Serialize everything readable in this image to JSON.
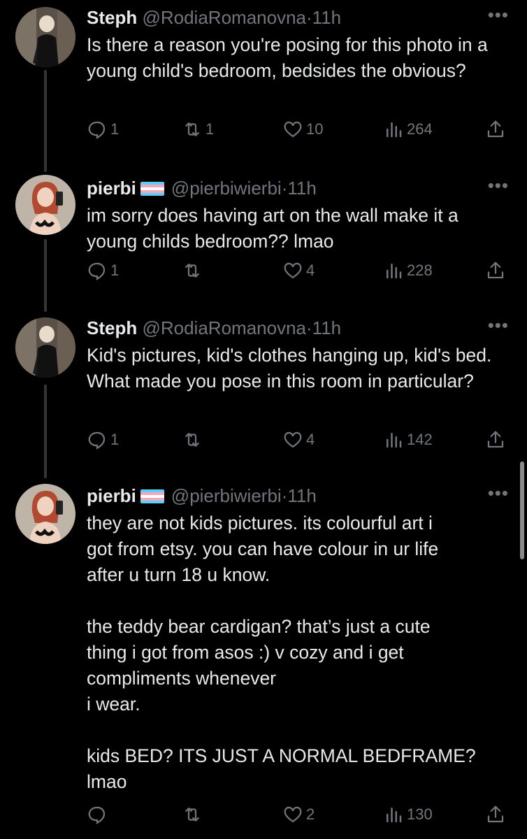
{
  "flag_colors": {
    "blue": "#5bcefa",
    "pink": "#f5a9b8",
    "white": "#ffffff"
  },
  "tweets": [
    {
      "name": "Steph",
      "handle": "@RodiaRomanovna",
      "time": "11h",
      "text": "Is there a reason you're posing for this photo in a young child's bedroom, bedsides the obvious?",
      "replies": "1",
      "retweets": "1",
      "likes": "10",
      "views": "264"
    },
    {
      "name": "pierbi",
      "handle": "@pierbiwierbi",
      "time": "11h",
      "text": "im sorry does having art on the wall make it a young childs bedroom?? lmao",
      "replies": "1",
      "retweets": "",
      "likes": "4",
      "views": "228"
    },
    {
      "name": "Steph",
      "handle": "@RodiaRomanovna",
      "time": "11h",
      "text": "Kid's pictures, kid's clothes hanging up, kid's bed. What made you pose in this room in particular?",
      "replies": "1",
      "retweets": "",
      "likes": "4",
      "views": "142"
    },
    {
      "name": "pierbi",
      "handle": "@pierbiwierbi",
      "time": "11h",
      "text": "they are not kids pictures. its colourful art i\ngot from etsy. you can have colour in ur life\nafter u turn 18 u know.\n\nthe teddy bear cardigan? that’s just a cute\nthing i got from asos :) v cozy and i get\ncompliments whenever\ni wear.\n\nkids BED? ITS JUST A NORMAL BEDFRAME?\nlmao",
      "replies": "",
      "retweets": "",
      "likes": "2",
      "views": "130"
    }
  ]
}
